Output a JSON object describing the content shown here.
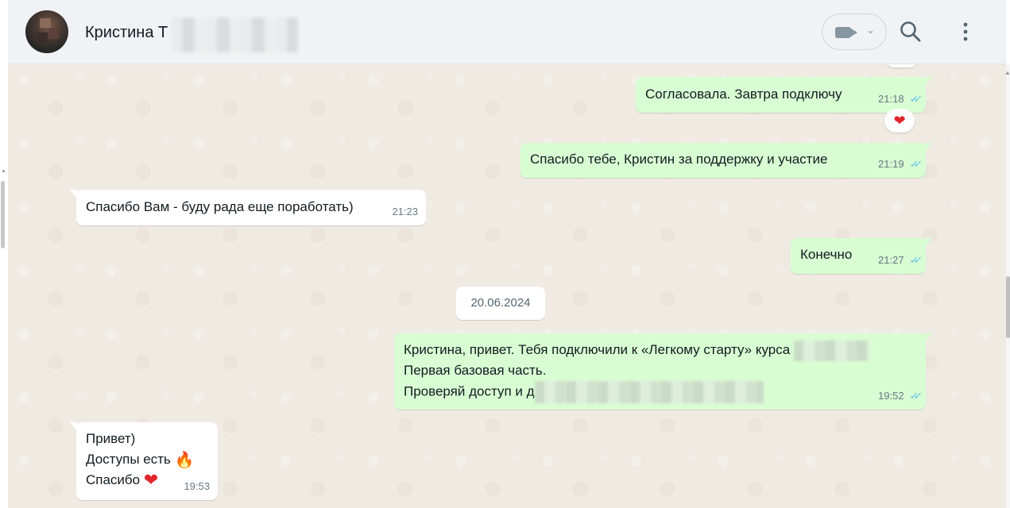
{
  "header": {
    "contact_name": "Кристина Т",
    "video_chevron": "⌄"
  },
  "date_divider": "20.06.2024",
  "messages": [
    {
      "dir": "out",
      "text": "Согласовала. Завтра подключу",
      "time": "21:18",
      "reaction": "❤"
    },
    {
      "dir": "out",
      "text": "Спасибо тебе, Кристин за поддержку и участие",
      "time": "21:19"
    },
    {
      "dir": "in",
      "text": "Спасибо Вам - буду рада еще поработать)",
      "time": "21:23"
    },
    {
      "dir": "out",
      "text": "Конечно",
      "time": "21:27"
    },
    {
      "dir": "out",
      "lines": [
        "Кристина, привет. Тебя подключили к «Легкому старту» курса",
        "Первая базовая часть.",
        "Проверяй доступ и д"
      ],
      "time": "19:52"
    },
    {
      "dir": "in",
      "lines": [
        "Привет)",
        "Доступы есть",
        "Спасибо"
      ],
      "emoji": [
        "🔥",
        "❤"
      ],
      "time": "19:53"
    }
  ],
  "ticks": "✓✓",
  "colors": {
    "header_bg": "#f0f2f5",
    "chat_bg": "#efeae2",
    "outgoing_bubble": "#d9fdd3",
    "incoming_bubble": "#ffffff",
    "read_ticks": "#53bdeb",
    "meta_text": "#667781"
  }
}
